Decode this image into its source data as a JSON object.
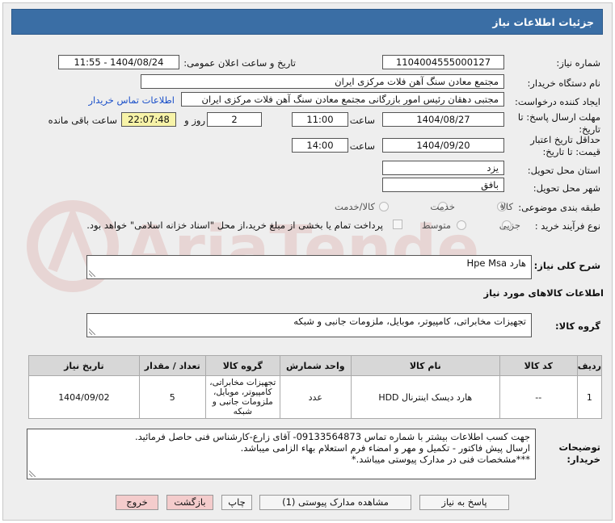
{
  "title": "جزئیات اطلاعات نیاز",
  "fields": {
    "need_number_label": "شماره نیاز:",
    "need_number": "1104004555000127",
    "announce_label": "تاریخ و ساعت اعلان عمومی:",
    "announce_value": "1404/08/24 - 11:55",
    "buyer_org_label": "نام دستگاه خریدار:",
    "buyer_org": "مجتمع معادن سنگ آهن فلات مرکزی ایران",
    "creator_label": "ایجاد کننده درخواست:",
    "creator": "مجتبی  دهقان رئیس امور بازرگانی مجتمع معادن سنگ آهن فلات مرکزی ایران",
    "contact_link": "اطلاعات تماس خریدار",
    "reply_deadline_label": "مهلت ارسال پاسخ: تا تاریخ:",
    "reply_date": "1404/08/27",
    "time_label": "ساعت",
    "reply_time": "11:00",
    "days_value": "2",
    "days_label": "روز و",
    "remaining_time": "22:07:48",
    "remaining_label": "ساعت باقی مانده",
    "validity_label": "حداقل تاریخ اعتبار قیمت: تا تاریخ:",
    "validity_date": "1404/09/20",
    "validity_time_label": "ساعت",
    "validity_time": "14:00",
    "province_label": "استان محل تحویل:",
    "province": "یزد",
    "city_label": "شهر محل تحویل:",
    "city": "بافق",
    "category_label": "طبقه بندی موضوعی:",
    "category_options": [
      "کالا",
      "خدمت",
      "کالا/خدمت"
    ],
    "process_label": "نوع فرآیند خرید :",
    "process_options": [
      "جزیی",
      "متوسط"
    ],
    "payment_note": "پرداخت تمام یا بخشی از مبلغ خرید،از محل \"اسناد خزانه اسلامی\" خواهد بود."
  },
  "description_label": "شرح کلی نیاز:",
  "description": "هارد Hpe Msa",
  "goods_info_heading": "اطلاعات کالاهای مورد نیاز",
  "goods_group_label": "گروه کالا:",
  "goods_group": "تجهیزات مخابراتی، کامپیوتر، موبایل، ملزومات جانبی و شبکه",
  "table": {
    "headers": [
      "ردیف",
      "کد کالا",
      "نام کالا",
      "واحد شمارش",
      "گروه کالا",
      "تعداد / مقدار",
      "تاریخ نیاز"
    ],
    "rows": [
      [
        "1",
        "--",
        "هارد دیسک اینترنال HDD",
        "عدد",
        "تجهیزات مخابراتی، کامپیوتر، موبایل، ملزومات جانبی و شبکه",
        "5",
        "1404/09/02"
      ]
    ]
  },
  "notes_label": "توضیحات خریدار:",
  "notes": [
    "جهت کسب اطلاعات بیشتر با شماره تماس 09133564873- آقای زارع-کارشناس فنی حاصل فرمائید.",
    "ارسال پیش فاکتور - تکمیل و مهر و امضاء فرم استعلام بهاء الزامی میباشد.",
    "***مشخصات فنی در مدارک پیوستی میباشد.*"
  ],
  "buttons": {
    "reply": "پاسخ به نیاز",
    "attachments": "مشاهده مدارک پیوستی (1)",
    "print": "چاپ",
    "back": "بازگشت",
    "exit": "خروج"
  },
  "watermark_text": "AriaTender.net",
  "colors": {
    "titlebar": "#3a6ea5",
    "link": "#1a4fc9",
    "remaining_bg": "#f7f3a8",
    "exit_bg": "#f4cccc"
  }
}
